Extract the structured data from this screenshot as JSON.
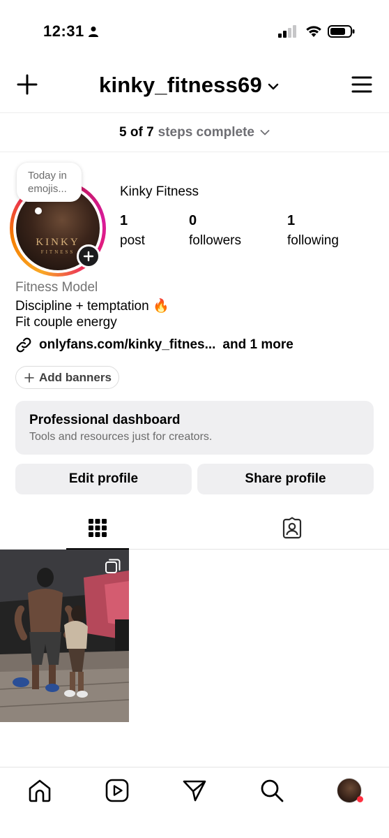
{
  "status_bar": {
    "time": "12:31"
  },
  "header": {
    "username": "kinky_fitness69"
  },
  "steps": {
    "count": "5 of 7",
    "label": "steps complete"
  },
  "note": {
    "text": "Today in emojis..."
  },
  "profile": {
    "avatar_logo": "KINKY",
    "avatar_logo_sub": "FITNESS",
    "display_name": "Kinky Fitness",
    "stats": [
      {
        "value": "1",
        "label": "post"
      },
      {
        "value": "0",
        "label": "followers"
      },
      {
        "value": "1",
        "label": "following"
      }
    ],
    "category": "Fitness Model",
    "bio_lines": [
      "Discipline + temptation 🔥",
      "Fit couple energy"
    ],
    "link": {
      "text": "onlyfans.com/kinky_fitnes...",
      "more": "and 1 more"
    },
    "add_banners_label": "Add banners"
  },
  "dashboard": {
    "title": "Professional dashboard",
    "subtitle": "Tools and resources just for creators."
  },
  "actions": {
    "edit_label": "Edit profile",
    "share_label": "Share profile"
  },
  "tabs": {
    "icons": [
      "grid-icon",
      "tagged-icon"
    ]
  },
  "nav": {
    "icons": [
      "home-icon",
      "reels-icon",
      "messages-icon",
      "search-icon",
      "profile-avatar"
    ]
  }
}
